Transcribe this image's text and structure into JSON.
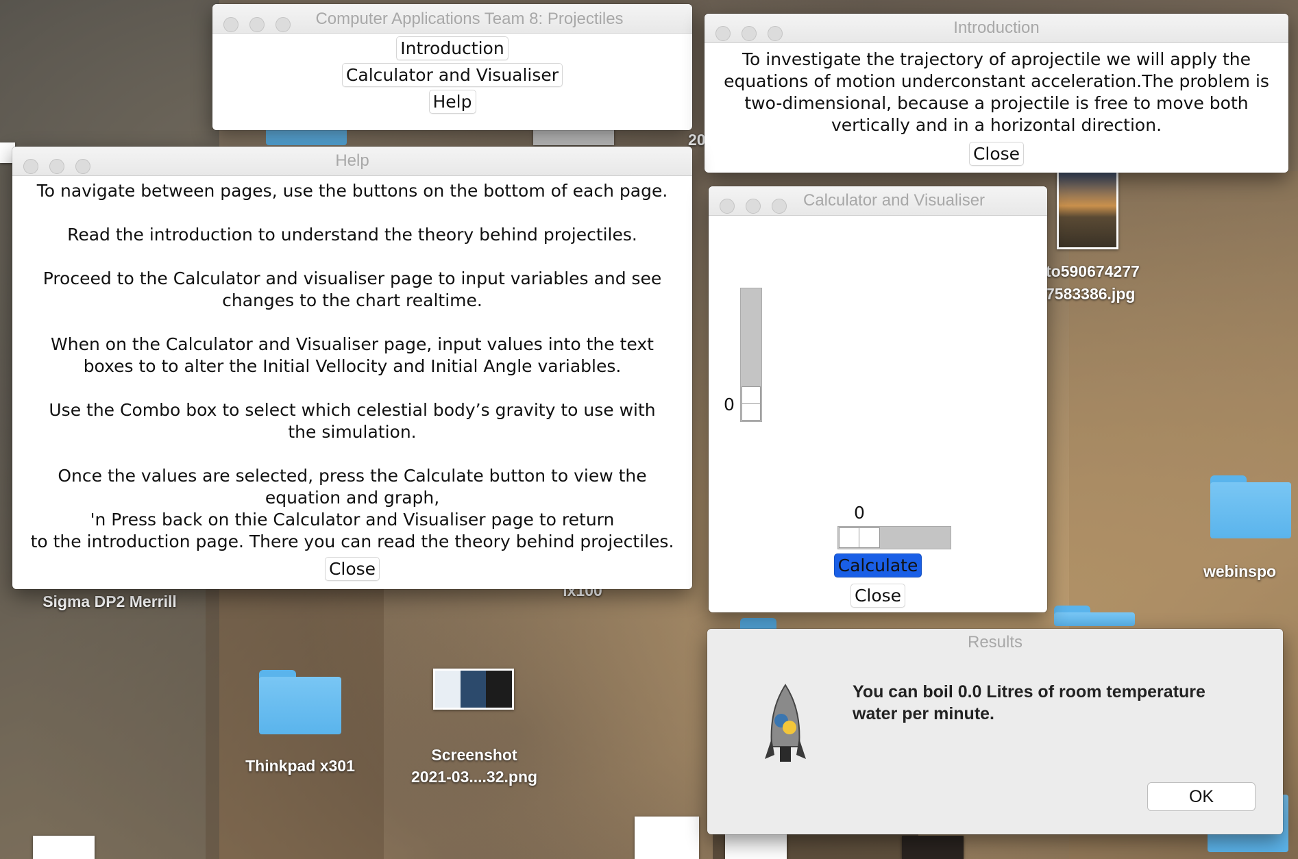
{
  "desktop": {
    "labels": {
      "sigma": "Sigma DP2 Merrill",
      "ix100": "ix100",
      "thinkpad": "Thinkpad x301",
      "screenshot_line1": "Screenshot",
      "screenshot_line2": "2021-03....32.png",
      "photo_line1": "to590674277",
      "photo_line2": "7583386.jpg",
      "webinspo": "webinspo",
      "partial_20": "20"
    }
  },
  "main_window": {
    "title": "Computer Applications Team 8: Projectiles",
    "buttons": {
      "introduction": "Introduction",
      "calculator": "Calculator and Visualiser",
      "help": "Help"
    }
  },
  "intro_window": {
    "title": "Introduction",
    "lines": [
      "To investigate the trajectory of aprojectile we will apply the",
      "equations of motion underconstant acceleration.The problem is",
      "two-dimensional, because a projectile is free to move both",
      "vertically and in a horizontal direction."
    ],
    "close": "Close"
  },
  "help_window": {
    "title": "Help",
    "lines": [
      "To navigate between pages, use the buttons on the bottom of each page.",
      "",
      "Read the introduction to understand the theory behind projectiles.",
      "",
      "Proceed to the Calculator and visualiser page to input variables and see",
      "changes to the chart realtime.",
      "",
      "When on the Calculator and Visualiser page, input values into the text",
      "boxes to to alter the Initial Vellocity and Initial Angle variables.",
      "",
      "Use the Combo box to select which celestial body’s gravity to use with",
      "the simulation.",
      "",
      "Once the values are selected, press the Calculate button to view the",
      "equation and graph,",
      "'n Press back on thie Calculator and Visualiser page to return",
      "to the introduction page. There you can read the theory behind projectiles."
    ],
    "close": "Close"
  },
  "calc_window": {
    "title": "Calculator and Visualiser",
    "vertical_slider_value": "0",
    "horizontal_slider_value": "0",
    "vertical_slider_level": 0,
    "horizontal_slider_level": 0,
    "calculate": "Calculate",
    "close": "Close",
    "accent": "#1a5fe6"
  },
  "results_dialog": {
    "title": "Results",
    "message_line1": "You can boil 0.0 Litres of room temperature",
    "message_line2": "water per minute.",
    "ok": "OK",
    "icon": "python-rocket-icon"
  }
}
